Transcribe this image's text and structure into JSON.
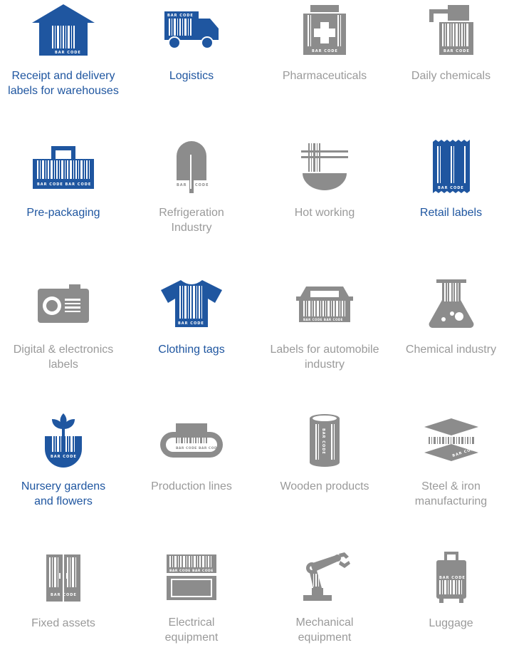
{
  "colors": {
    "active": "#1f56a0",
    "inactive": "#9a9a9a",
    "icon_inactive": "#8c8c8c"
  },
  "icon_text": {
    "bar_code": "BAR CODE",
    "bar_code_double": "BAR CODE BAR CODE",
    "bar": "BAR",
    "code": "CODE"
  },
  "industries": [
    {
      "label": "Receipt and delivery\nlabels for warehouses",
      "icon": "warehouse-icon",
      "highlighted": true
    },
    {
      "label": "Logistics",
      "icon": "truck-icon",
      "highlighted": true
    },
    {
      "label": "Pharmaceuticals",
      "icon": "medicine-box-icon",
      "highlighted": false
    },
    {
      "label": "Daily chemicals",
      "icon": "spray-bottle-icon",
      "highlighted": false
    },
    {
      "label": "Pre-packaging",
      "icon": "shopping-bag-icon",
      "highlighted": true
    },
    {
      "label": "Refrigeration\nIndustry",
      "icon": "ice-pop-icon",
      "highlighted": false
    },
    {
      "label": "Hot working",
      "icon": "noodle-bowl-icon",
      "highlighted": false
    },
    {
      "label": "Retail labels",
      "icon": "snack-package-icon",
      "highlighted": true
    },
    {
      "label": "Digital & electronics\nlabels",
      "icon": "camera-icon",
      "highlighted": false
    },
    {
      "label": "Clothing tags",
      "icon": "t-shirt-icon",
      "highlighted": true
    },
    {
      "label": "Labels for automobile\nindustry",
      "icon": "car-icon",
      "highlighted": false
    },
    {
      "label": "Chemical industry",
      "icon": "flask-icon",
      "highlighted": false
    },
    {
      "label": "Nursery gardens\nand flowers",
      "icon": "plant-pot-icon",
      "highlighted": true
    },
    {
      "label": "Production lines",
      "icon": "conveyor-belt-icon",
      "highlighted": false
    },
    {
      "label": "Wooden products",
      "icon": "log-icon",
      "highlighted": false
    },
    {
      "label": "Steel & iron\nmanufacturing",
      "icon": "steel-plate-icon",
      "highlighted": false
    },
    {
      "label": "Fixed assets",
      "icon": "cabinet-icon",
      "highlighted": false
    },
    {
      "label": "Electrical\nequipment",
      "icon": "electrical-box-icon",
      "highlighted": false
    },
    {
      "label": "Mechanical\nequipment",
      "icon": "robot-arm-icon",
      "highlighted": false
    },
    {
      "label": "Luggage",
      "icon": "suitcase-icon",
      "highlighted": false
    }
  ]
}
